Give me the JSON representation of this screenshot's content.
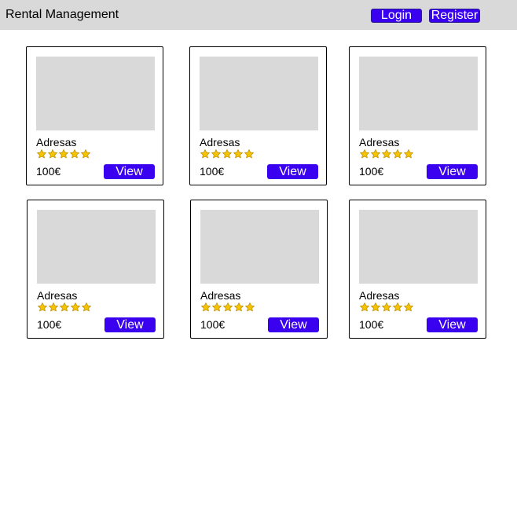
{
  "header": {
    "title": "Rental Management",
    "login_label": "Login",
    "register_label": "Register"
  },
  "colors": {
    "header_bg": "#d9d9d9",
    "accent": "#3a00f0",
    "image_placeholder": "#d9d9d9",
    "star": "#f5c400"
  },
  "listings": [
    {
      "title": "Adresas",
      "rating": 5,
      "price": "100€",
      "view_label": "View"
    },
    {
      "title": "Adresas",
      "rating": 5,
      "price": "100€",
      "view_label": "View"
    },
    {
      "title": "Adresas",
      "rating": 5,
      "price": "100€",
      "view_label": "View"
    },
    {
      "title": "Adresas",
      "rating": 5,
      "price": "100€",
      "view_label": "View"
    },
    {
      "title": "Adresas",
      "rating": 5,
      "price": "100€",
      "view_label": "View"
    },
    {
      "title": "Adresas",
      "rating": 5,
      "price": "100€",
      "view_label": "View"
    }
  ],
  "icons": {
    "rating": "star-icon"
  }
}
